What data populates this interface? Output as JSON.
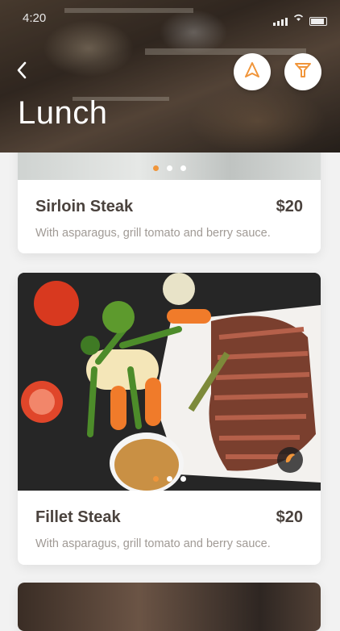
{
  "status": {
    "time": "4:20"
  },
  "header": {
    "title": "Lunch",
    "back_icon": "chevron-left-icon",
    "navigate_icon": "navigation-arrow-icon",
    "filter_icon": "filter-icon"
  },
  "colors": {
    "accent": "#f0953a",
    "text": "#4a423d",
    "muted": "#a09a95"
  },
  "menu_items": [
    {
      "name": "Sirloin Steak",
      "price": "$20",
      "description": "With asparagus, grill tomato and berry sauce."
    },
    {
      "name": "Fillet Steak",
      "price": "$20",
      "description": "With asparagus, grill tomato and berry sauce."
    }
  ]
}
